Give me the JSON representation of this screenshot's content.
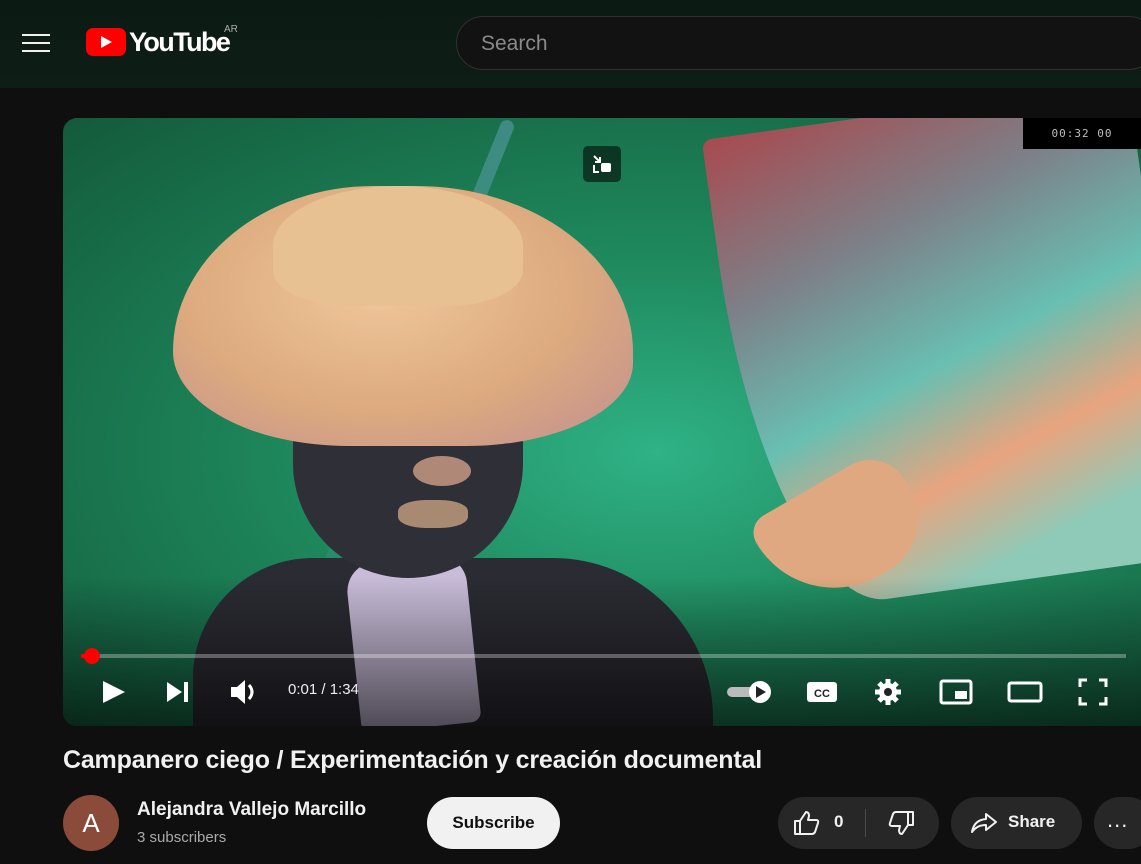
{
  "header": {
    "logo_text": "YouTube",
    "region": "AR",
    "search_placeholder": "Search"
  },
  "player": {
    "overlay_timestamp": "00:32 00",
    "current_time": "0:01",
    "duration": "1:34",
    "time_display": "0:01 / 1:34",
    "progress_fraction": 0.011,
    "accent_color": "#ff0000"
  },
  "video": {
    "title": "Campanero ciego / Experimentación y creación documental"
  },
  "channel": {
    "avatar_letter": "A",
    "name": "Alejandra Vallejo Marcillo",
    "subscribers": "3 subscribers",
    "subscribe_label": "Subscribe"
  },
  "actions": {
    "like_count": "0",
    "share_label": "Share",
    "more_label": "..."
  }
}
